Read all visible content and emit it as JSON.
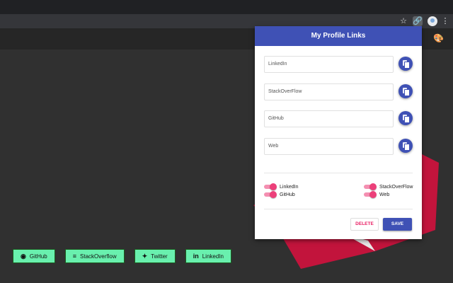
{
  "popup": {
    "title": "My Profile Links",
    "fields": [
      {
        "placeholder": "LinkedIn",
        "value": ""
      },
      {
        "placeholder": "StackOverFlow",
        "value": ""
      },
      {
        "placeholder": "GitHub",
        "value": ""
      },
      {
        "placeholder": "Web",
        "value": ""
      }
    ],
    "toggles": [
      {
        "label": "LinkedIn",
        "on": true
      },
      {
        "label": "StackOverFlow",
        "on": true
      },
      {
        "label": "GitHub",
        "on": true
      },
      {
        "label": "Web",
        "on": true
      }
    ],
    "delete_label": "DELETE",
    "save_label": "SAVE"
  },
  "page_links": [
    {
      "label": "GitHub",
      "icon": "github-icon"
    },
    {
      "label": "StackOverflow",
      "icon": "stackoverflow-icon"
    },
    {
      "label": "Twitter",
      "icon": "twitter-icon"
    },
    {
      "label": "LinkedIn",
      "icon": "linkedin-icon"
    }
  ],
  "colors": {
    "accent": "#3f51b5",
    "toggle": "#ec407a",
    "link_button": "#69f0ae",
    "delete_text": "#e91e63"
  }
}
